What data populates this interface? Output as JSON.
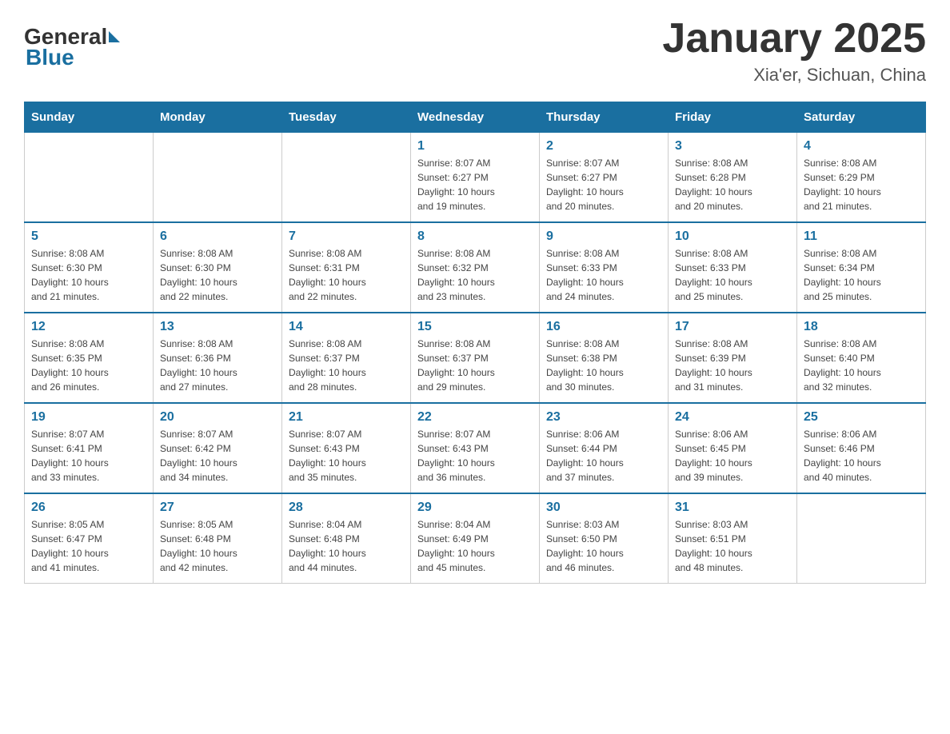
{
  "header": {
    "logo": {
      "general": "General",
      "blue": "Blue"
    },
    "title": "January 2025",
    "subtitle": "Xia'er, Sichuan, China"
  },
  "days_of_week": [
    "Sunday",
    "Monday",
    "Tuesday",
    "Wednesday",
    "Thursday",
    "Friday",
    "Saturday"
  ],
  "weeks": [
    [
      {
        "day": "",
        "info": ""
      },
      {
        "day": "",
        "info": ""
      },
      {
        "day": "",
        "info": ""
      },
      {
        "day": "1",
        "info": "Sunrise: 8:07 AM\nSunset: 6:27 PM\nDaylight: 10 hours\nand 19 minutes."
      },
      {
        "day": "2",
        "info": "Sunrise: 8:07 AM\nSunset: 6:27 PM\nDaylight: 10 hours\nand 20 minutes."
      },
      {
        "day": "3",
        "info": "Sunrise: 8:08 AM\nSunset: 6:28 PM\nDaylight: 10 hours\nand 20 minutes."
      },
      {
        "day": "4",
        "info": "Sunrise: 8:08 AM\nSunset: 6:29 PM\nDaylight: 10 hours\nand 21 minutes."
      }
    ],
    [
      {
        "day": "5",
        "info": "Sunrise: 8:08 AM\nSunset: 6:30 PM\nDaylight: 10 hours\nand 21 minutes."
      },
      {
        "day": "6",
        "info": "Sunrise: 8:08 AM\nSunset: 6:30 PM\nDaylight: 10 hours\nand 22 minutes."
      },
      {
        "day": "7",
        "info": "Sunrise: 8:08 AM\nSunset: 6:31 PM\nDaylight: 10 hours\nand 22 minutes."
      },
      {
        "day": "8",
        "info": "Sunrise: 8:08 AM\nSunset: 6:32 PM\nDaylight: 10 hours\nand 23 minutes."
      },
      {
        "day": "9",
        "info": "Sunrise: 8:08 AM\nSunset: 6:33 PM\nDaylight: 10 hours\nand 24 minutes."
      },
      {
        "day": "10",
        "info": "Sunrise: 8:08 AM\nSunset: 6:33 PM\nDaylight: 10 hours\nand 25 minutes."
      },
      {
        "day": "11",
        "info": "Sunrise: 8:08 AM\nSunset: 6:34 PM\nDaylight: 10 hours\nand 25 minutes."
      }
    ],
    [
      {
        "day": "12",
        "info": "Sunrise: 8:08 AM\nSunset: 6:35 PM\nDaylight: 10 hours\nand 26 minutes."
      },
      {
        "day": "13",
        "info": "Sunrise: 8:08 AM\nSunset: 6:36 PM\nDaylight: 10 hours\nand 27 minutes."
      },
      {
        "day": "14",
        "info": "Sunrise: 8:08 AM\nSunset: 6:37 PM\nDaylight: 10 hours\nand 28 minutes."
      },
      {
        "day": "15",
        "info": "Sunrise: 8:08 AM\nSunset: 6:37 PM\nDaylight: 10 hours\nand 29 minutes."
      },
      {
        "day": "16",
        "info": "Sunrise: 8:08 AM\nSunset: 6:38 PM\nDaylight: 10 hours\nand 30 minutes."
      },
      {
        "day": "17",
        "info": "Sunrise: 8:08 AM\nSunset: 6:39 PM\nDaylight: 10 hours\nand 31 minutes."
      },
      {
        "day": "18",
        "info": "Sunrise: 8:08 AM\nSunset: 6:40 PM\nDaylight: 10 hours\nand 32 minutes."
      }
    ],
    [
      {
        "day": "19",
        "info": "Sunrise: 8:07 AM\nSunset: 6:41 PM\nDaylight: 10 hours\nand 33 minutes."
      },
      {
        "day": "20",
        "info": "Sunrise: 8:07 AM\nSunset: 6:42 PM\nDaylight: 10 hours\nand 34 minutes."
      },
      {
        "day": "21",
        "info": "Sunrise: 8:07 AM\nSunset: 6:43 PM\nDaylight: 10 hours\nand 35 minutes."
      },
      {
        "day": "22",
        "info": "Sunrise: 8:07 AM\nSunset: 6:43 PM\nDaylight: 10 hours\nand 36 minutes."
      },
      {
        "day": "23",
        "info": "Sunrise: 8:06 AM\nSunset: 6:44 PM\nDaylight: 10 hours\nand 37 minutes."
      },
      {
        "day": "24",
        "info": "Sunrise: 8:06 AM\nSunset: 6:45 PM\nDaylight: 10 hours\nand 39 minutes."
      },
      {
        "day": "25",
        "info": "Sunrise: 8:06 AM\nSunset: 6:46 PM\nDaylight: 10 hours\nand 40 minutes."
      }
    ],
    [
      {
        "day": "26",
        "info": "Sunrise: 8:05 AM\nSunset: 6:47 PM\nDaylight: 10 hours\nand 41 minutes."
      },
      {
        "day": "27",
        "info": "Sunrise: 8:05 AM\nSunset: 6:48 PM\nDaylight: 10 hours\nand 42 minutes."
      },
      {
        "day": "28",
        "info": "Sunrise: 8:04 AM\nSunset: 6:48 PM\nDaylight: 10 hours\nand 44 minutes."
      },
      {
        "day": "29",
        "info": "Sunrise: 8:04 AM\nSunset: 6:49 PM\nDaylight: 10 hours\nand 45 minutes."
      },
      {
        "day": "30",
        "info": "Sunrise: 8:03 AM\nSunset: 6:50 PM\nDaylight: 10 hours\nand 46 minutes."
      },
      {
        "day": "31",
        "info": "Sunrise: 8:03 AM\nSunset: 6:51 PM\nDaylight: 10 hours\nand 48 minutes."
      },
      {
        "day": "",
        "info": ""
      }
    ]
  ]
}
